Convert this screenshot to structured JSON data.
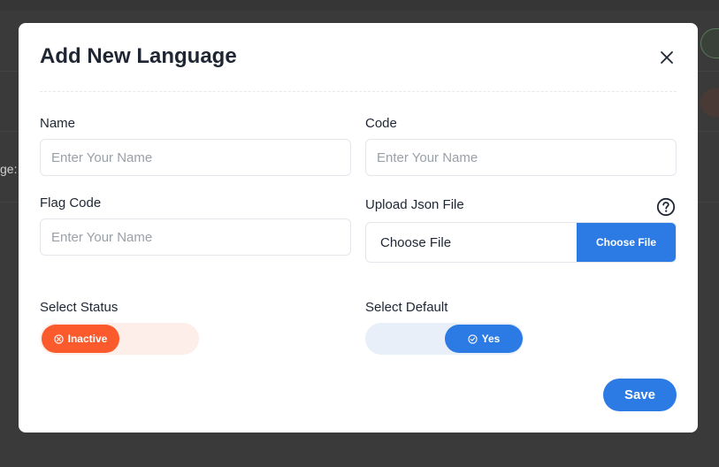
{
  "background": {
    "partial_text": "ge:"
  },
  "modal": {
    "title": "Add New Language",
    "close_icon": "close-icon",
    "fields": {
      "name": {
        "label": "Name",
        "placeholder": "Enter Your Name",
        "value": ""
      },
      "code": {
        "label": "Code",
        "placeholder": "Enter Your Name",
        "value": ""
      },
      "flag_code": {
        "label": "Flag Code",
        "placeholder": "Enter Your Name",
        "value": ""
      },
      "upload": {
        "label": "Upload Json File",
        "file_text": "Choose File",
        "button_label": "Choose File",
        "help_icon": "question-circle-icon"
      }
    },
    "status": {
      "label": "Select Status",
      "value": "Inactive",
      "icon": "x-circle-icon",
      "color": "#fb5a2c"
    },
    "default": {
      "label": "Select Default",
      "value": "Yes",
      "icon": "check-circle-icon",
      "color": "#2c7be5"
    },
    "save_label": "Save",
    "accent_color": "#2c7be5"
  }
}
